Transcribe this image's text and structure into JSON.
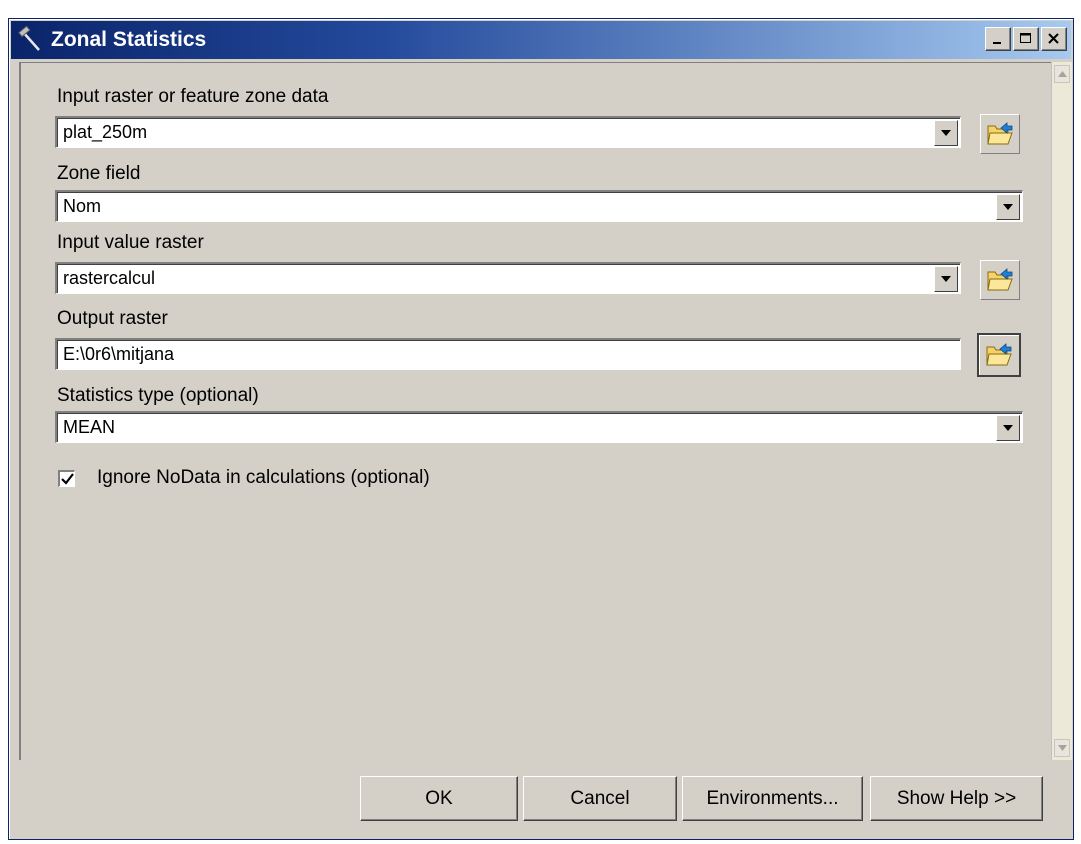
{
  "window": {
    "title": "Zonal Statistics",
    "controls": {
      "minimize": "_",
      "maximize": "□",
      "close": "×"
    }
  },
  "form": {
    "input_zone": {
      "label": "Input raster or feature zone data",
      "value": "plat_250m"
    },
    "zone_field": {
      "label": "Zone field",
      "value": "Nom"
    },
    "input_value_raster": {
      "label": "Input value raster",
      "value": "rastercalcul"
    },
    "output_raster": {
      "label": "Output raster",
      "value": "E:\\0r6\\mitjana"
    },
    "statistics_type": {
      "label": "Statistics type (optional)",
      "value": "MEAN"
    },
    "ignore_nodata": {
      "label": "Ignore NoData in calculations (optional)",
      "checked": true
    }
  },
  "buttons": {
    "ok": "OK",
    "cancel": "Cancel",
    "environments": "Environments...",
    "show_help": "Show Help >>"
  },
  "icons": {
    "title": "hammer-icon",
    "browse": "open-folder-icon"
  },
  "colors": {
    "titlebar_start": "#0a246a",
    "titlebar_end": "#a6caf0",
    "face": "#d4d0c8"
  }
}
